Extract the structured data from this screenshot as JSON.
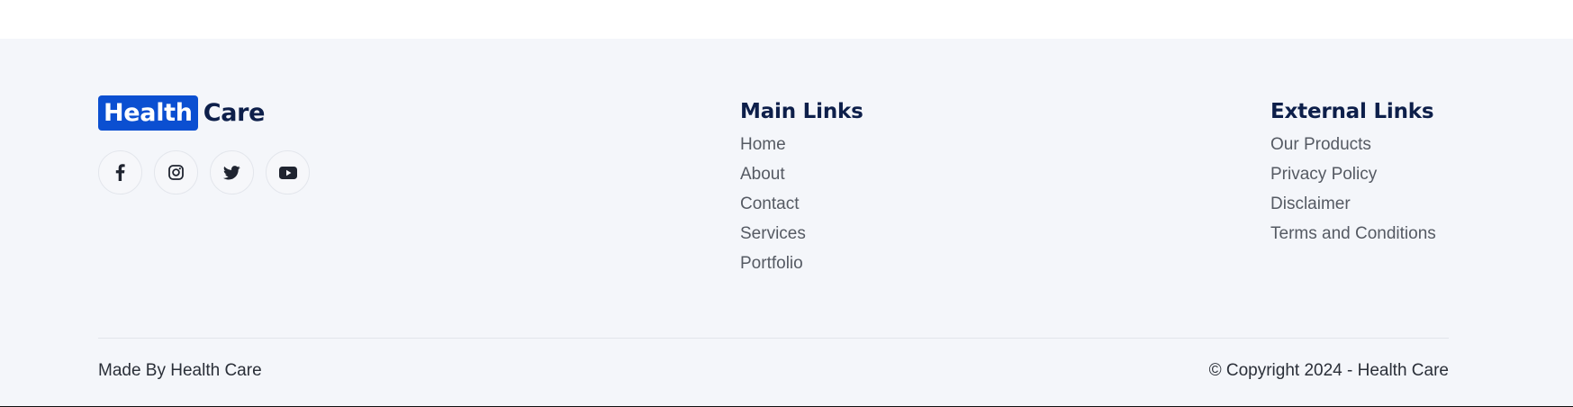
{
  "brand": {
    "highlight": "Health",
    "rest": "Care",
    "highlight_bg": "#0b4fd1",
    "text_color": "#0d1f4a"
  },
  "social": [
    {
      "name": "facebook-icon"
    },
    {
      "name": "instagram-icon"
    },
    {
      "name": "twitter-icon"
    },
    {
      "name": "youtube-icon"
    }
  ],
  "main_links": {
    "title": "Main Links",
    "items": [
      "Home",
      "About",
      "Contact",
      "Services",
      "Portfolio"
    ]
  },
  "external_links": {
    "title": "External Links",
    "items": [
      "Our Products",
      "Privacy Policy",
      "Disclaimer",
      "Terms and Conditions"
    ]
  },
  "bottom": {
    "made_by": "Made By Health Care",
    "copyright": "© Copyright 2024 - Health Care"
  },
  "colors": {
    "footer_bg": "#f4f6fa",
    "link_text": "#555a63",
    "accent": "#0b4fd1"
  }
}
